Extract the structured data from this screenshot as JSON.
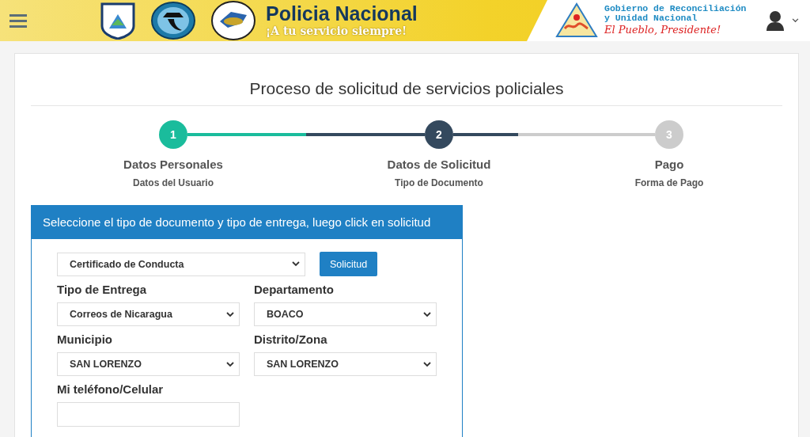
{
  "header": {
    "brand_title": "Policia Nacional",
    "brand_tagline": "¡A tu servicio siempre!",
    "gov_line1": "Gobierno de Reconciliación",
    "gov_line2": "y Unidad Nacional",
    "gov_slogan": "El Pueblo, Presidente!"
  },
  "page_title": "Proceso de solicitud de servicios policiales",
  "steps": [
    {
      "number": "1",
      "title": "Datos Personales",
      "subtitle": "Datos del Usuario",
      "kind": "done"
    },
    {
      "number": "2",
      "title": "Datos de Solicitud",
      "subtitle": "Tipo de Documento",
      "kind": "active"
    },
    {
      "number": "3",
      "title": "Pago",
      "subtitle": "Forma de Pago",
      "kind": "pending"
    }
  ],
  "form": {
    "heading": "Seleccione el tipo de documento y tipo de entrega, luego click en solicitud",
    "document_type": "Certificado de Conducta",
    "submit": "Solicitud",
    "fields": [
      {
        "kind": "select",
        "label": "Tipo de Entrega",
        "value": "Correos de Nicaragua"
      },
      {
        "kind": "select",
        "label": "Departamento",
        "value": "BOACO"
      },
      {
        "kind": "select",
        "label": "Municipio",
        "value": "SAN LORENZO"
      },
      {
        "kind": "select",
        "label": "Distrito/Zona",
        "value": "SAN LORENZO"
      },
      {
        "kind": "text",
        "label": "Mi teléfono/Celular"
      }
    ]
  }
}
